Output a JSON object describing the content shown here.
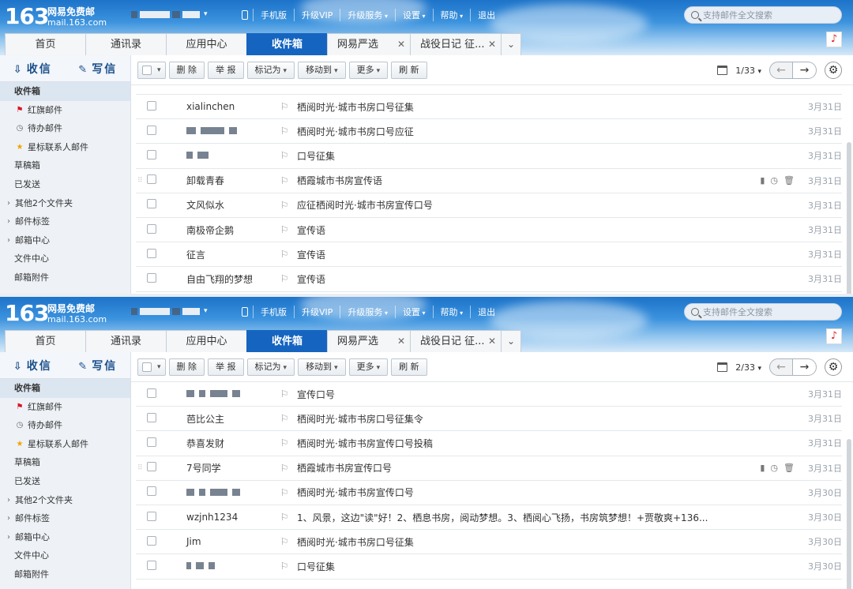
{
  "panels": [
    {
      "logo": {
        "number": "163",
        "title": "网易免费邮",
        "domain": "mail.163.com"
      },
      "top_links": [
        "手机版",
        "升级VIP",
        "升级服务",
        "设置",
        "帮助",
        "退出"
      ],
      "search_placeholder": "支持邮件全文搜索",
      "tabs": [
        {
          "label": "首页"
        },
        {
          "label": "通讯录"
        },
        {
          "label": "应用中心"
        },
        {
          "label": "收件箱",
          "active": true
        },
        {
          "label": "网易严选",
          "closable": true
        },
        {
          "label": "战役日记 征...",
          "closable": true
        }
      ],
      "sidebar": {
        "receive": "收信",
        "compose": "写信",
        "items": [
          "收件箱",
          "红旗邮件",
          "待办邮件",
          "星标联系人邮件",
          "草稿箱",
          "已发送",
          "其他2个文件夹",
          "邮件标签",
          "邮箱中心",
          "文件中心",
          "邮箱附件"
        ]
      },
      "toolbar": {
        "delete": "删 除",
        "report": "举 报",
        "mark_as": "标记为",
        "move_to": "移动到",
        "more": "更多",
        "refresh": "刷 新",
        "pager": "1/33"
      },
      "emails": [
        {
          "sender": "xialinchen",
          "subject": "栖阅时光·城市书房口号征集",
          "date": "3月31日"
        },
        {
          "sender": "",
          "subject": "栖阅时光·城市书房口号应征",
          "date": "3月31日"
        },
        {
          "sender": "",
          "subject": "口号征集",
          "date": "3月31日"
        },
        {
          "sender": "卸载青春",
          "subject": "栖霞城市书房宣传语",
          "date": "3月31日"
        },
        {
          "sender": "文风似水",
          "subject": "应征栖阅时光·城市书房宣传口号",
          "date": "3月31日"
        },
        {
          "sender": "南极帝企鹅",
          "subject": "宣传语",
          "date": "3月31日"
        },
        {
          "sender": "征言",
          "subject": "宣传语",
          "date": "3月31日"
        },
        {
          "sender": "自由飞翔的梦想",
          "subject": "宣传语",
          "date": "3月31日"
        }
      ]
    },
    {
      "logo": {
        "number": "163",
        "title": "网易免费邮",
        "domain": "mail.163.com"
      },
      "top_links": [
        "手机版",
        "升级VIP",
        "升级服务",
        "设置",
        "帮助",
        "退出"
      ],
      "search_placeholder": "支持邮件全文搜索",
      "tabs": [
        {
          "label": "首页"
        },
        {
          "label": "通讯录"
        },
        {
          "label": "应用中心"
        },
        {
          "label": "收件箱",
          "active": true
        },
        {
          "label": "网易严选",
          "closable": true
        },
        {
          "label": "战役日记 征...",
          "closable": true
        }
      ],
      "sidebar": {
        "receive": "收信",
        "compose": "写信",
        "items": [
          "收件箱",
          "红旗邮件",
          "待办邮件",
          "星标联系人邮件",
          "草稿箱",
          "已发送",
          "其他2个文件夹",
          "邮件标签",
          "邮箱中心",
          "文件中心",
          "邮箱附件"
        ]
      },
      "toolbar": {
        "delete": "删 除",
        "report": "举 报",
        "mark_as": "标记为",
        "move_to": "移动到",
        "more": "更多",
        "refresh": "刷 新",
        "pager": "2/33"
      },
      "emails": [
        {
          "sender": "",
          "subject": "宣传口号",
          "date": "3月31日"
        },
        {
          "sender": "芭比公主",
          "subject": "栖阅时光·城市书房口号征集令",
          "date": "3月31日"
        },
        {
          "sender": "恭喜发财",
          "subject": "栖阅时光·城市书房宣传口号投稿",
          "date": "3月31日"
        },
        {
          "sender": "7号同学",
          "subject": "栖霞城市书房宣传口号",
          "date": "3月31日"
        },
        {
          "sender": "",
          "subject": "栖阅时光·城市书房宣传口号",
          "date": "3月30日"
        },
        {
          "sender": "wzjnh1234",
          "subject": "1、风景，这边\"读\"好！2、栖息书房，阅动梦想。3、栖阅心飞扬，书房筑梦想！+贾敬爽+136...",
          "date": "3月30日"
        },
        {
          "sender": "Jim",
          "subject": "栖阅时光·城市书房口号征集",
          "date": "3月30日"
        },
        {
          "sender": "",
          "subject": "口号征集",
          "date": "3月30日"
        }
      ]
    }
  ]
}
